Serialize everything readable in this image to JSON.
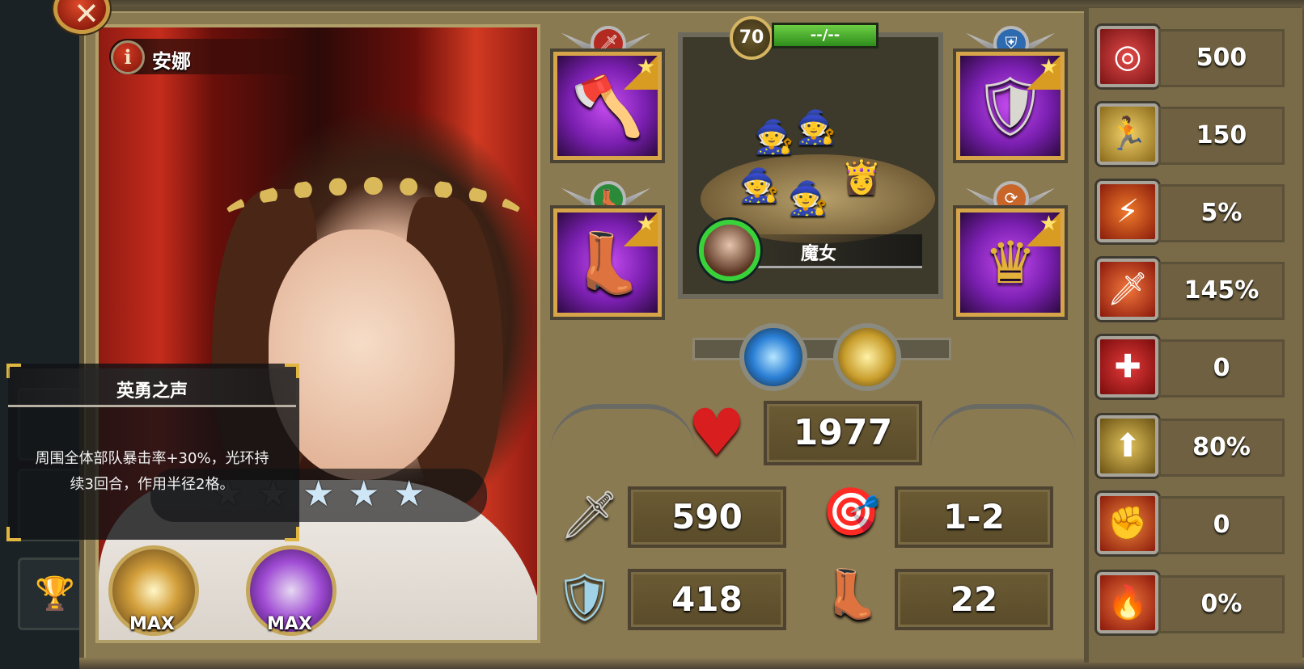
{
  "hero": {
    "name": "安娜",
    "info_icon": "i"
  },
  "skill": {
    "title": "英勇之声",
    "description_line1": "周围全体部队暴击率+30%，光环持",
    "description_line2": "续3回合，作用半径2格。"
  },
  "stars": {
    "total": 5,
    "lit": 3
  },
  "badges": [
    {
      "label": "MAX"
    },
    {
      "label": "MAX"
    }
  ],
  "unit": {
    "level": "70",
    "hp_text": "--/--",
    "name": "魔女"
  },
  "stats": {
    "health": "1977",
    "attack": "590",
    "range": "1-2",
    "defense": "418",
    "move": "22"
  },
  "attributes": [
    {
      "icon": "target-icon",
      "value": "500"
    },
    {
      "icon": "dodge-icon",
      "value": "150"
    },
    {
      "icon": "critical-icon",
      "value": "5%"
    },
    {
      "icon": "crit-damage-icon",
      "value": "145%"
    },
    {
      "icon": "heal-icon",
      "value": "0"
    },
    {
      "icon": "rank-up-icon",
      "value": "80%"
    },
    {
      "icon": "power-fist-icon",
      "value": "0"
    },
    {
      "icon": "rage-icon",
      "value": "0%"
    }
  ],
  "colors": {
    "accent_gold": "#d6a54a",
    "hp_green": "#4caf30",
    "rarity_purple": "#7a1fb0"
  }
}
